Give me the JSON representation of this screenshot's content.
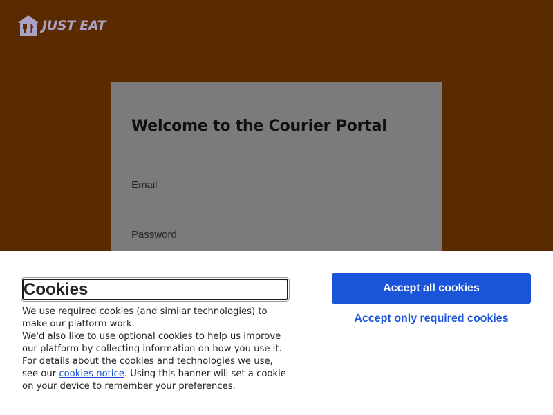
{
  "brand": {
    "logo_icon": "house-fork-icon",
    "logo_text": "JUST EAT"
  },
  "login_card": {
    "title": "Welcome to the Courier Portal",
    "email_label": "Email",
    "password_label": "Password"
  },
  "cookie_banner": {
    "heading": "Cookies",
    "text_before_link": "We use required cookies (and similar technologies) to make our platform work.\nWe'd also like to use optional cookies to help us improve our platform by collecting information on how you use it.\nFor details about the cookies and technologies we use, see our ",
    "link_text": "cookies notice",
    "text_after_link": ". Using this banner will set a cookie on your device to remember your preferences.",
    "accept_all_label": "Accept all cookies",
    "accept_required_label": "Accept only required cookies"
  },
  "colors": {
    "page_background": "#5a2a00",
    "card_background": "#7b7b7b",
    "button_primary": "#1a55d9",
    "logo": "#a9a2c4"
  }
}
